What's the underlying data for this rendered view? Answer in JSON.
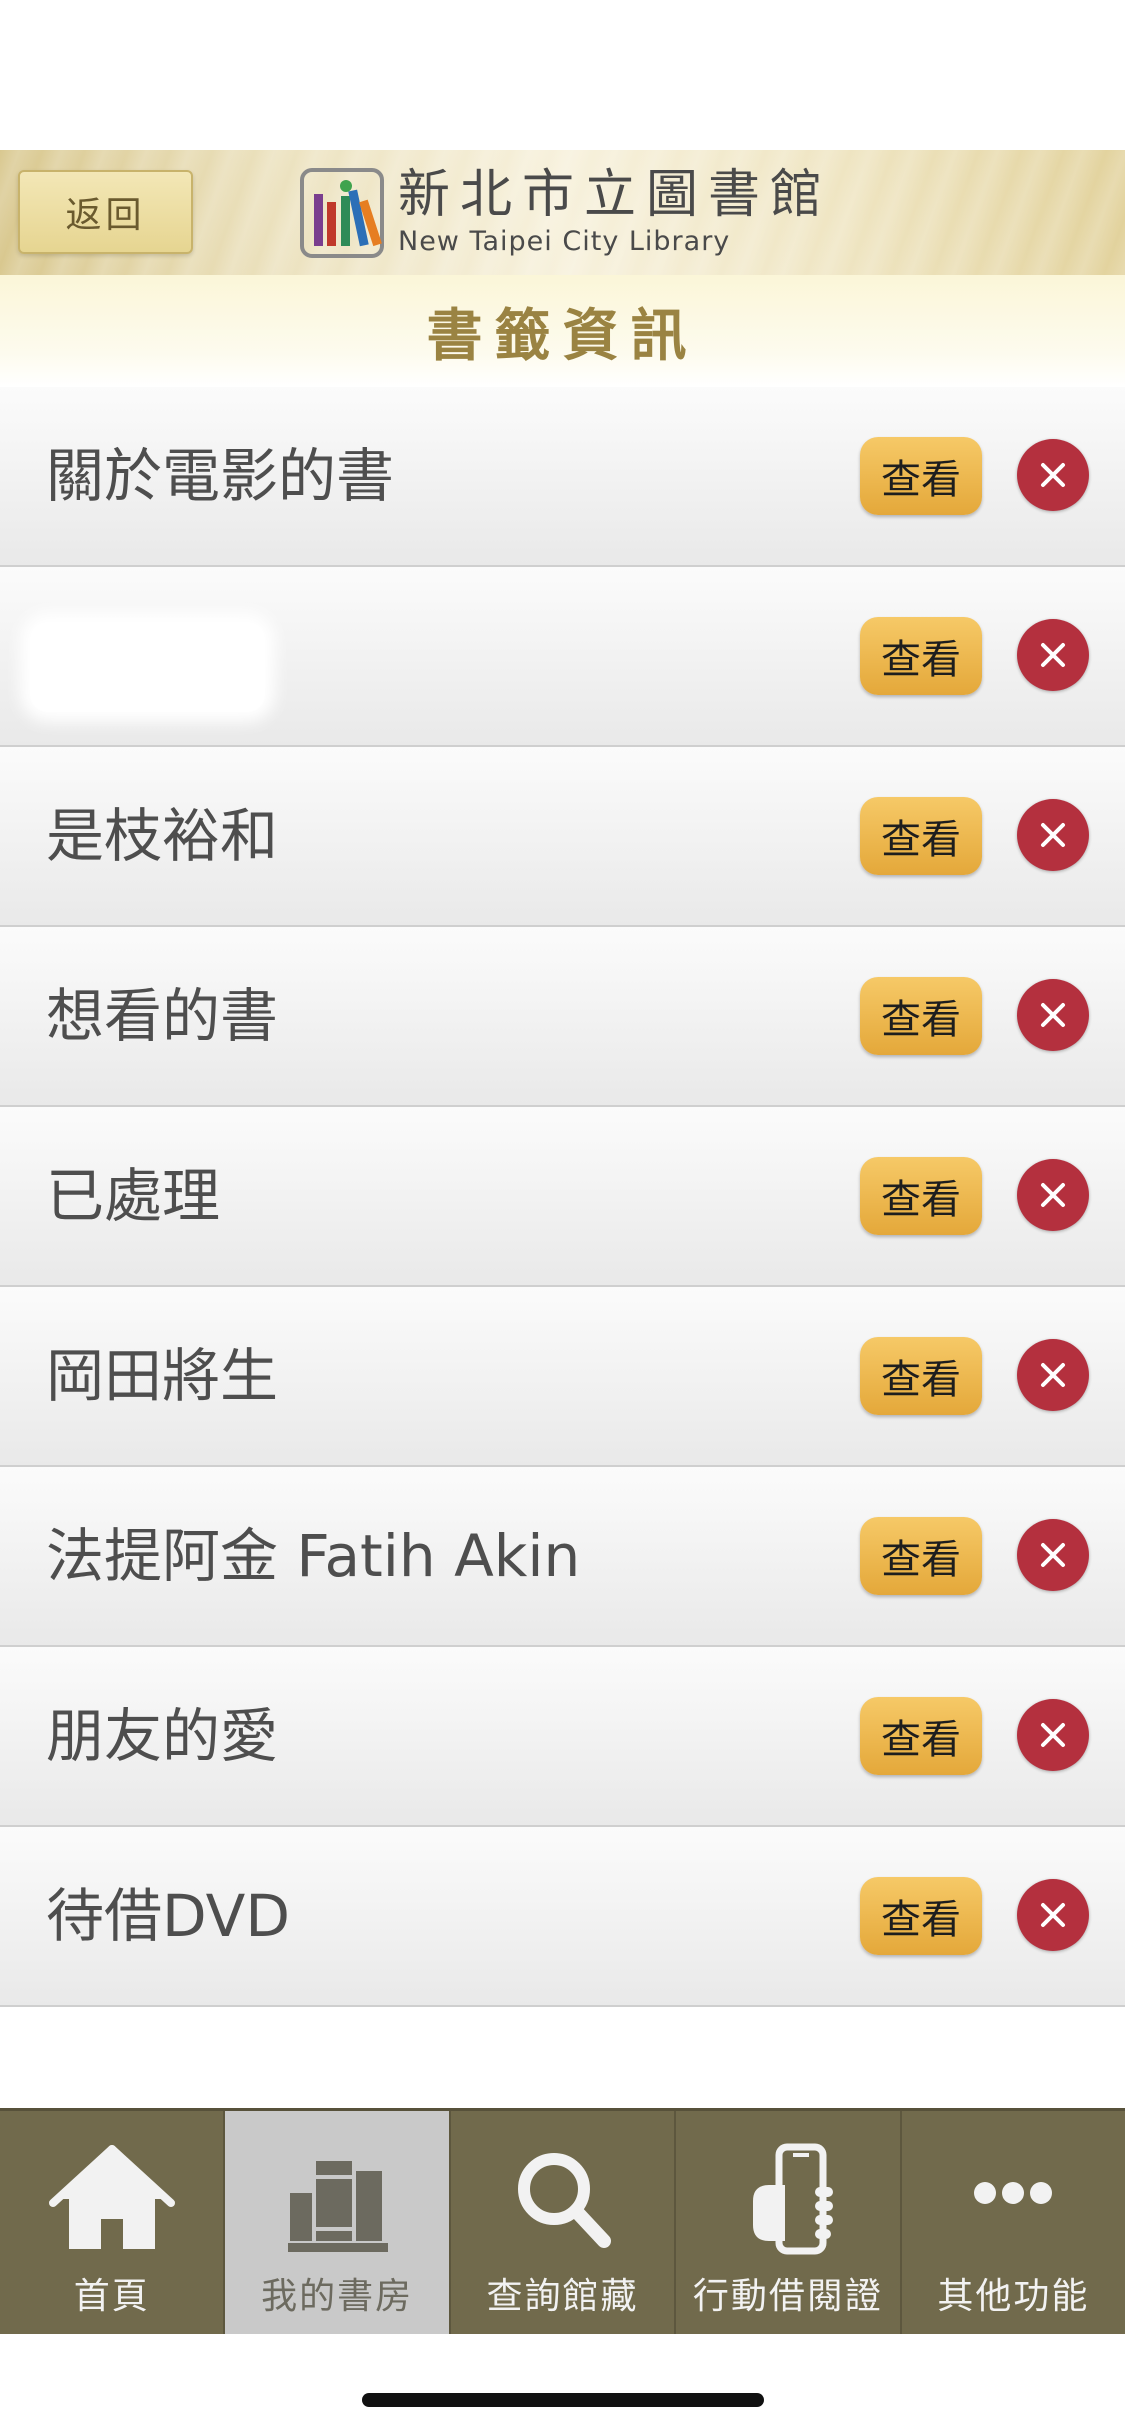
{
  "header": {
    "back_label": "返回",
    "library_name_cn": "新北市立圖書館",
    "library_name_en": "New Taipei City Library"
  },
  "page_title": "書籤資訊",
  "bookmarks": [
    {
      "label": "關於電影的書",
      "view_label": "查看"
    },
    {
      "label": "",
      "view_label": "查看"
    },
    {
      "label": "是枝裕和",
      "view_label": "查看"
    },
    {
      "label": "想看的書",
      "view_label": "查看"
    },
    {
      "label": "已處理",
      "view_label": "查看"
    },
    {
      "label": "岡田將生",
      "view_label": "查看"
    },
    {
      "label": "法提阿金 Fatih Akin",
      "view_label": "查看"
    },
    {
      "label": "朋友的愛",
      "view_label": "查看"
    },
    {
      "label": "待借DVD",
      "view_label": "查看"
    }
  ],
  "tabbar": {
    "items": [
      {
        "label": "首頁",
        "icon": "home-icon"
      },
      {
        "label": "我的書房",
        "icon": "bookshelf-icon",
        "active": true
      },
      {
        "label": "查詢館藏",
        "icon": "search-icon"
      },
      {
        "label": "行動借閱證",
        "icon": "mobile-card-icon"
      },
      {
        "label": "其他功能",
        "icon": "more-icon"
      }
    ]
  },
  "colors": {
    "view_button": "#e8ae40",
    "delete_button": "#b4303e",
    "tabbar": "#716a4c",
    "title_text": "#9a8342"
  }
}
